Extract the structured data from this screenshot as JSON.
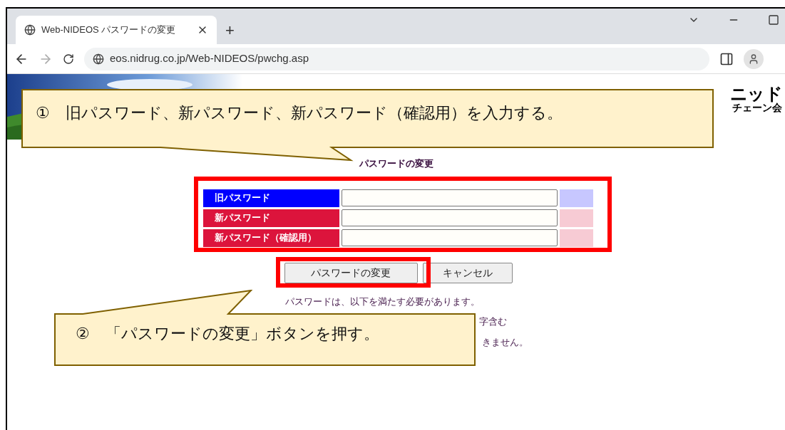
{
  "browser": {
    "tab": {
      "title": "Web-NIDEOS パスワードの変更",
      "selected": true
    },
    "new_tab": "+",
    "url": "eos.nidrug.co.jp/Web-NIDEOS/pwchg.asp"
  },
  "page": {
    "logo": [
      "ニッド",
      "チェーン会"
    ],
    "title": "パスワードの変更",
    "rows": [
      {
        "label": "旧パスワード",
        "color": "#0000ff"
      },
      {
        "label": "新パスワード",
        "color": "#dc143c"
      },
      {
        "label": "新パスワード（確認用）",
        "color": "#dc143c"
      }
    ],
    "buttons": [
      "パスワードの変更",
      "キャンセル"
    ],
    "notes": [
      "パスワードは、以下を満たす必要があります。",
      "字含む",
      "きません。"
    ]
  },
  "annotations": [
    {
      "number": "①",
      "text": "旧パスワード、新パスワード、新パスワード（確認用）を入力する。"
    },
    {
      "number": "②",
      "text": "「パスワードの変更」ボタンを押す。"
    }
  ]
}
